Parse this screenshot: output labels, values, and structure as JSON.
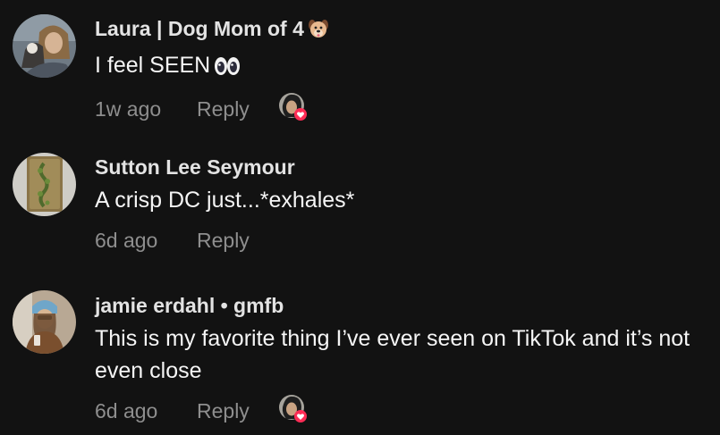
{
  "comments": [
    {
      "author": "Laura | Dog Mom of 4",
      "author_emoji": "dog-face-icon",
      "text": "I feel SEEN",
      "text_emoji": "eyes-icon",
      "time": "1w ago",
      "reply_label": "Reply",
      "liked_by_creator": true
    },
    {
      "author": "Sutton Lee Seymour",
      "text": "A crisp DC just...*exhales*",
      "time": "6d ago",
      "reply_label": "Reply",
      "liked_by_creator": false
    },
    {
      "author": "jamie erdahl • gmfb",
      "text": "This is my favorite thing I’ve ever seen on TikTok and it’s not even close",
      "time": "6d ago",
      "reply_label": "Reply",
      "liked_by_creator": true
    }
  ],
  "colors": {
    "background": "#121212",
    "author": "#e3e3e3",
    "text": "#f5f5f5",
    "meta": "#8e8e8e",
    "heart_badge": "#fe2c55"
  }
}
